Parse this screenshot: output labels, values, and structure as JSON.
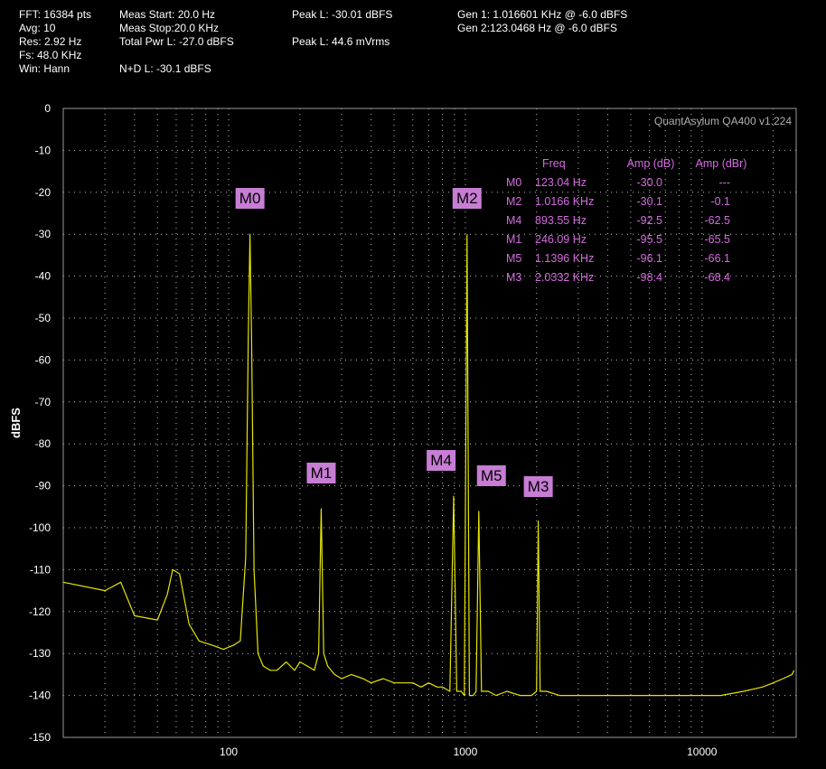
{
  "header": {
    "col1": [
      "FFT: 16384 pts",
      "Avg: 10",
      "Res: 2.92 Hz",
      "Fs: 48.0 KHz",
      "Win: Hann"
    ],
    "col2": [
      "Meas Start: 20.0 Hz",
      "Meas Stop:20.0 KHz",
      "Total Pwr L: -27.0 dBFS",
      "N+D L: -30.1 dBFS"
    ],
    "col3": [
      "Peak L: -30.01 dBFS",
      "Peak L: 44.6 mVrms"
    ],
    "col4": [
      "Gen 1: 1.016601 KHz @ -6.0  dBFS",
      "Gen 2:123.0468 Hz @ -6.0  dBFS"
    ]
  },
  "watermark": "QuantAsylum QA400 v1.224",
  "colors": {
    "trace": "#e6e600",
    "marker": "#c77dd4",
    "table_text": "#d56be0",
    "grid": "#bdbdbd",
    "background": "#000000"
  },
  "marker_table": {
    "headers": [
      "Freq",
      "Amp (dB)",
      "Amp (dBr)"
    ],
    "rows": [
      {
        "m": "M0",
        "freq": "123.04 Hz",
        "amp": "-30.0",
        "dbr": "---"
      },
      {
        "m": "M2",
        "freq": "1.0166 KHz",
        "amp": "-30.1",
        "dbr": "-0.1"
      },
      {
        "m": "M4",
        "freq": "893.55 Hz",
        "amp": "-92.5",
        "dbr": "-62.5"
      },
      {
        "m": "M1",
        "freq": "246.09 Hz",
        "amp": "-95.5",
        "dbr": "-65.5"
      },
      {
        "m": "M5",
        "freq": "1.1396 KHz",
        "amp": "-96.1",
        "dbr": "-66.1"
      },
      {
        "m": "M3",
        "freq": "2.0332 KHz",
        "amp": "-98.4",
        "dbr": "-68.4"
      }
    ]
  },
  "chart_data": {
    "type": "line",
    "title": "",
    "xlabel": "",
    "ylabel": "dBFS",
    "x_scale": "log",
    "xlim": [
      20,
      25000
    ],
    "ylim": [
      -150,
      0
    ],
    "x_tick_labels": [
      "100",
      "1000",
      "10000"
    ],
    "x_ticks": [
      100,
      1000,
      10000
    ],
    "y_ticks": [
      0,
      -10,
      -20,
      -30,
      -40,
      -50,
      -60,
      -70,
      -80,
      -90,
      -100,
      -110,
      -120,
      -130,
      -140,
      -150
    ],
    "grid": true,
    "markers": [
      {
        "name": "M0",
        "freq": 123.04,
        "amp": -30.0
      },
      {
        "name": "M1",
        "freq": 246.09,
        "amp": -95.5
      },
      {
        "name": "M2",
        "freq": 1016.6,
        "amp": -30.1
      },
      {
        "name": "M3",
        "freq": 2033.2,
        "amp": -98.4
      },
      {
        "name": "M4",
        "freq": 893.55,
        "amp": -92.5
      },
      {
        "name": "M5",
        "freq": 1139.6,
        "amp": -96.1
      }
    ],
    "series": [
      {
        "x": [
          20,
          30,
          35,
          40,
          50,
          55,
          58,
          62,
          68,
          75,
          85,
          95,
          105,
          112,
          118,
          121,
          123,
          125,
          128,
          133,
          140,
          150,
          160,
          175,
          190,
          200,
          215,
          230,
          240,
          246,
          252,
          262,
          280,
          300,
          330,
          370,
          400,
          450,
          500,
          550,
          600,
          650,
          700,
          760,
          800,
          860,
          893,
          920,
          960,
          990,
          1016.6,
          1040,
          1080,
          1110,
          1140,
          1170,
          1250,
          1350,
          1500,
          1700,
          1900,
          2000,
          2033,
          2070,
          2200,
          2500,
          3000,
          3500,
          4000,
          5000,
          6000,
          7000,
          8000,
          10000,
          12000,
          15000,
          18000,
          20000,
          22000,
          24000,
          24500
        ],
        "y": [
          -113,
          -115,
          -113,
          -121,
          -122,
          -116,
          -110,
          -111,
          -123,
          -127,
          -128,
          -129,
          -128,
          -127,
          -107,
          -55,
          -30,
          -55,
          -110,
          -130,
          -133,
          -134,
          -134,
          -132,
          -134,
          -132,
          -133,
          -134,
          -130,
          -95.5,
          -130,
          -133,
          -135,
          -136,
          -135,
          -136,
          -137,
          -136,
          -137,
          -137,
          -137,
          -138,
          -137,
          -138,
          -138,
          -139,
          -92.5,
          -139,
          -139,
          -140,
          -30.1,
          -140,
          -140,
          -139,
          -96.1,
          -139,
          -139,
          -140,
          -139,
          -140,
          -140,
          -139,
          -98.4,
          -139,
          -139,
          -140,
          -140,
          -140,
          -140,
          -140,
          -140,
          -140,
          -140,
          -140,
          -140,
          -139,
          -138,
          -137,
          -136,
          -135,
          -134
        ]
      }
    ]
  }
}
